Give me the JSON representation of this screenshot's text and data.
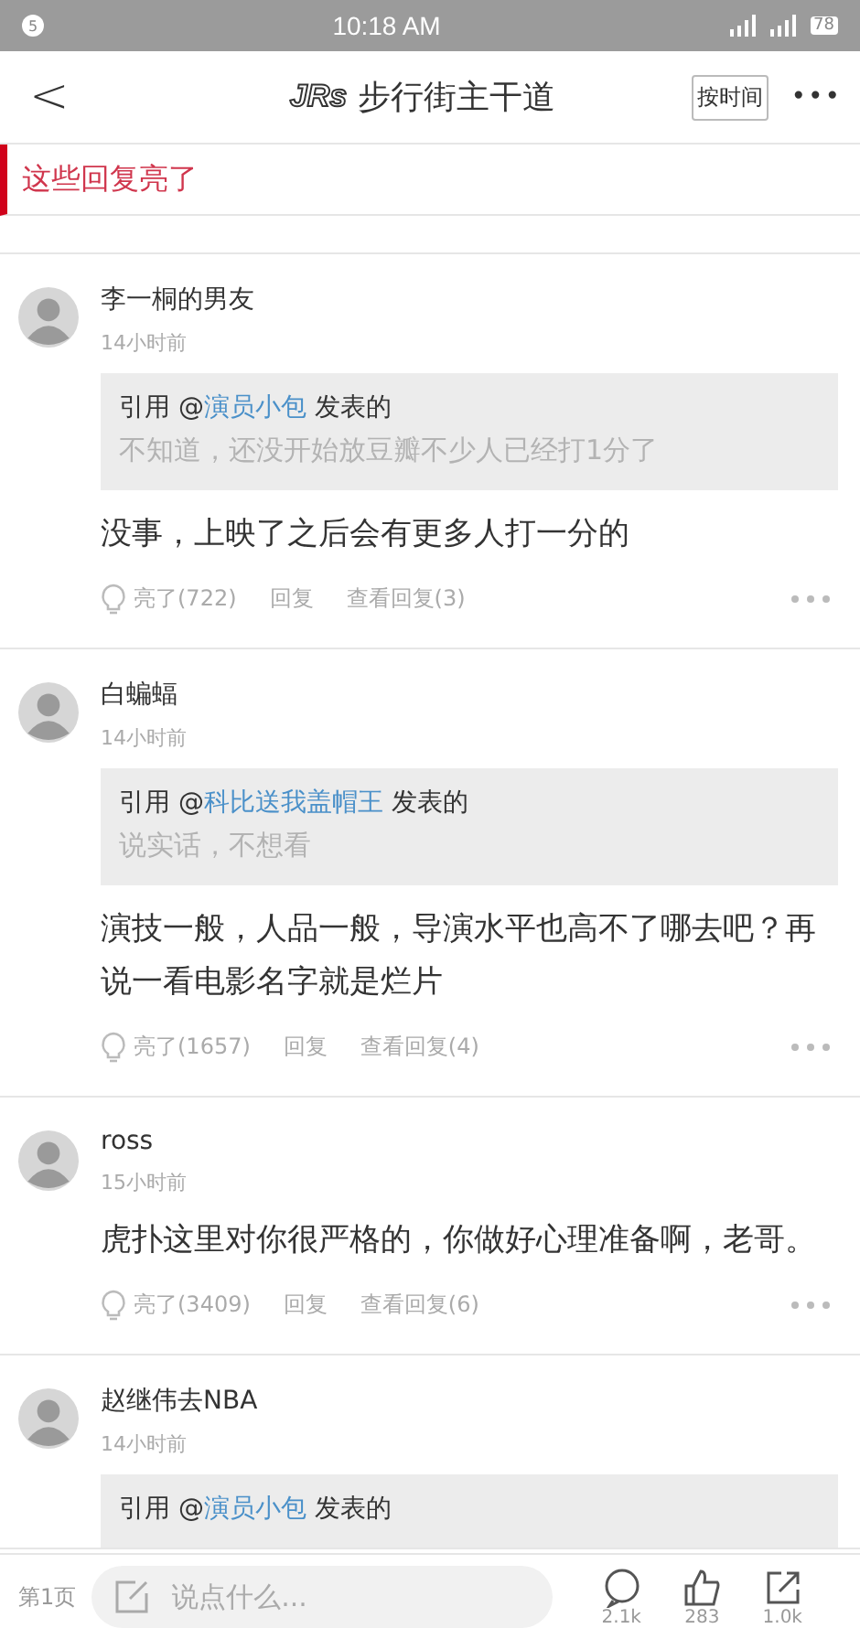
{
  "status_bar": {
    "notification_count": "5",
    "time": "10:18 AM",
    "battery": "78"
  },
  "header": {
    "back": "<",
    "logo": "JRs",
    "title": "步行街主干道",
    "sort_button": "按时间",
    "more": "•••"
  },
  "banner": {
    "title": "这些回复亮了"
  },
  "comments": [
    {
      "name": "李一桐的男友",
      "time": "14小时前",
      "quote": {
        "prefix": "引用 @",
        "author": "演员小包",
        "suffix": " 发表的",
        "text": "不知道，还没开始放豆瓣不少人已经打1分了"
      },
      "body": "没事，上映了之后会有更多人打一分的",
      "likes": "亮了(722)",
      "reply": "回复",
      "view_replies": "查看回复(3)"
    },
    {
      "name": "白蝙蝠",
      "time": "14小时前",
      "quote": {
        "prefix": "引用 @",
        "author": "科比送我盖帽王",
        "suffix": " 发表的",
        "text": "说实话，不想看"
      },
      "body": "演技一般，人品一般，导演水平也高不了哪去吧？再说一看电影名字就是烂片",
      "likes": "亮了(1657)",
      "reply": "回复",
      "view_replies": "查看回复(4)"
    },
    {
      "name": "ross",
      "time": "15小时前",
      "body": "虎扑这里对你很严格的，你做好心理准备啊，老哥。",
      "likes": "亮了(3409)",
      "reply": "回复",
      "view_replies": "查看回复(6)"
    },
    {
      "name": "赵继伟去NBA",
      "time": "14小时前",
      "quote": {
        "prefix": "引用 @",
        "author": "演员小包",
        "suffix": " 发表的"
      }
    }
  ],
  "bottom_bar": {
    "page": "第1页",
    "placeholder": "说点什么...",
    "counts": [
      "2.1k",
      "283",
      "1.0k"
    ]
  }
}
